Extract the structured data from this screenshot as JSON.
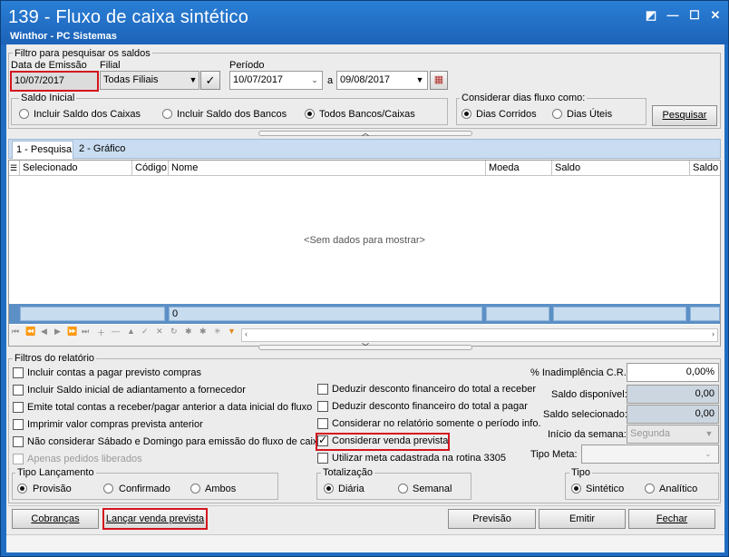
{
  "title": "139 - Fluxo de caixa sintético",
  "subtitle": "Winthor - PC Sistemas",
  "winctl": {
    "restore": "◩",
    "minimize": "—",
    "maximize": "☐",
    "close": "✕"
  },
  "filtro": {
    "group": "Filtro para pesquisar os saldos",
    "data_emissao_label": "Data de Emissão",
    "data_emissao_value": "10/07/2017",
    "filial_label": "Filial",
    "filial_value": "Todas Filiais",
    "periodo_label": "Período",
    "periodo_start": "10/07/2017",
    "a_label": "a",
    "periodo_end": "09/08/2017",
    "saldo_inicial_group": "Saldo Inicial",
    "saldo_opts": [
      "Incluir Saldo dos Caixas",
      "Incluir Saldo dos Bancos",
      "Todos Bancos/Caixas"
    ],
    "saldo_selected": 2,
    "dias_group": "Considerar dias fluxo como:",
    "dias_opts": [
      "Dias Corridos",
      "Dias Úteis"
    ],
    "dias_selected": 0,
    "pesquisar": "Pesquisar"
  },
  "tabs": [
    "1 - Pesquisa",
    "2 - Gráfico"
  ],
  "grid": {
    "columns": [
      "Selecionado",
      "Código",
      "Nome",
      "Moeda",
      "Saldo",
      "Saldo se"
    ],
    "empty": "<Sem dados para mostrar>",
    "footer_count": "0"
  },
  "relatorio": {
    "group": "Filtros do relatório",
    "left_checks": [
      {
        "label": "Incluir contas a pagar previsto compras",
        "checked": false,
        "enabled": true
      },
      {
        "label": "Incluir Saldo inicial de adiantamento a fornecedor",
        "checked": false,
        "enabled": true
      },
      {
        "label": "Emite total contas a receber/pagar anterior a data inicial do fluxo",
        "checked": false,
        "enabled": true
      },
      {
        "label": "Imprimir valor compras prevista anterior",
        "checked": false,
        "enabled": true
      },
      {
        "label": "Não considerar Sábado e Domingo para emissão do fluxo de caixa",
        "checked": false,
        "enabled": true
      },
      {
        "label": "Apenas pedidos liberados",
        "checked": false,
        "enabled": false
      }
    ],
    "mid_checks": [
      {
        "label": "Deduzir desconto financeiro do total a receber",
        "checked": false
      },
      {
        "label": "Deduzir desconto financeiro do total a pagar",
        "checked": false
      },
      {
        "label": "Considerar no relatório somente o período info.",
        "checked": false
      },
      {
        "label": "Considerar venda prevista",
        "checked": true
      },
      {
        "label": "Utilizar meta cadastrada na rotina 3305",
        "checked": false
      }
    ],
    "inadimplencia_label": "% Inadimplência C.R.",
    "inadimplencia_value": "0,00%",
    "saldo_disp_label": "Saldo disponível:",
    "saldo_disp_value": "0,00",
    "saldo_sel_label": "Saldo selecionado:",
    "saldo_sel_value": "0,00",
    "inicio_semana_label": "Início da semana:",
    "inicio_semana_value": "Segunda",
    "tipo_meta_label": "Tipo Meta:",
    "tipo_lanc_group": "Tipo Lançamento",
    "tipo_lanc_opts": [
      "Provisão",
      "Confirmado",
      "Ambos"
    ],
    "tipo_lanc_selected": 0,
    "total_group": "Totalização",
    "total_opts": [
      "Diária",
      "Semanal"
    ],
    "total_selected": 0,
    "tipo_group": "Tipo",
    "tipo_opts": [
      "Sintético",
      "Analítico"
    ],
    "tipo_selected": 0
  },
  "buttons": {
    "cobrancas": "Cobranças",
    "lancar": "Lançar venda prevista",
    "previsao": "Previsão",
    "emitir": "Emitir",
    "fechar": "Fechar"
  },
  "colors": {
    "title_bar": "#1f6dc2",
    "highlight": "#d4141e",
    "tab_strip": "#c9dcf1"
  }
}
